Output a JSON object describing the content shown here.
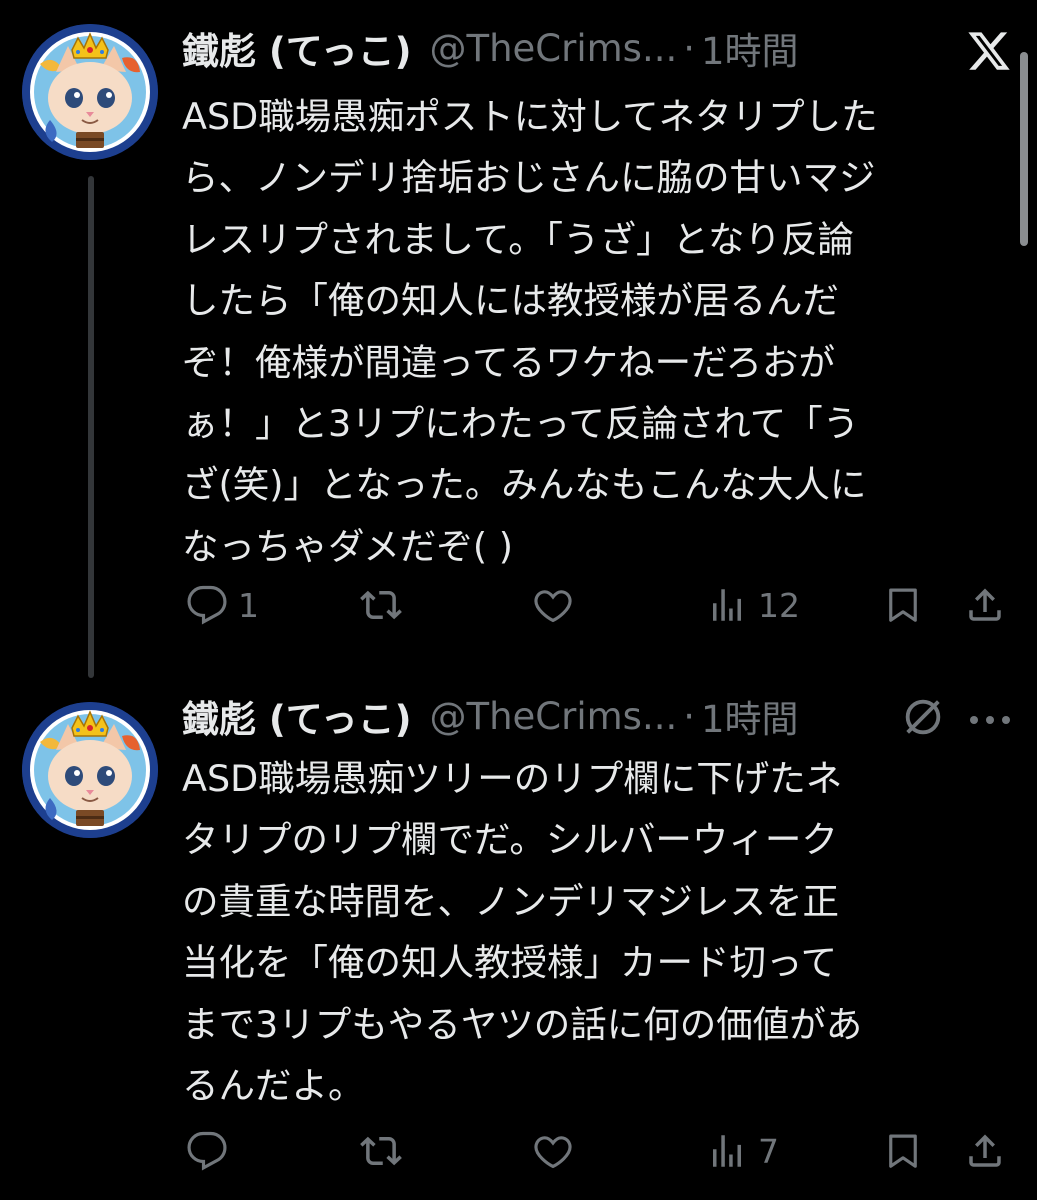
{
  "tweets": [
    {
      "name": "鐵彪 (てっこ)",
      "handle": "@TheCrims...",
      "dot": "·",
      "time": "1時間",
      "avatar_icon": "cat-avatar-icon",
      "body_lines": [
        "ASD職場愚痴ポストに対してネタリプした",
        "ら、ノンデリ捨垢おじさんに脇の甘いマジ",
        "レスリプされまして。「うざ」となり反論",
        "したら「俺の知人には教授様が居るんだ",
        "ぞ！俺様が間違ってるワケねーだろおが",
        "ぁ！」と3リプにわたって反論されて「う",
        "ざ(笑)」となった。みんなもこんな大人に",
        "なっちゃダメだぞ( )"
      ],
      "reply_count": "1",
      "retweet_count": "",
      "like_count": "",
      "views_count": "12"
    },
    {
      "name": "鐵彪 (てっこ)",
      "handle": "@TheCrims...",
      "dot": "·",
      "time": "1時間",
      "avatar_icon": "cat-avatar-icon",
      "body_lines": [
        "ASD職場愚痴ツリーのリプ欄に下げたネ",
        "タリプのリプ欄でだ。シルバーウィーク",
        "の貴重な時間を、ノンデリマジレスを正",
        "当化を「俺の知人教授様」カード切って",
        "まで3リプもやるヤツの話に何の価値があ",
        "るんだよ。"
      ],
      "reply_count": "",
      "retweet_count": "",
      "like_count": "",
      "views_count": "7"
    }
  ],
  "icons": {
    "top_right": "x-logo-icon",
    "second_tweet_badge": "no-entry-icon",
    "more": "more-options-icon"
  },
  "colors": {
    "background": "#000000",
    "primary_text": "#e7e9ea",
    "secondary_text": "#71767b",
    "thread_line": "#333639"
  }
}
